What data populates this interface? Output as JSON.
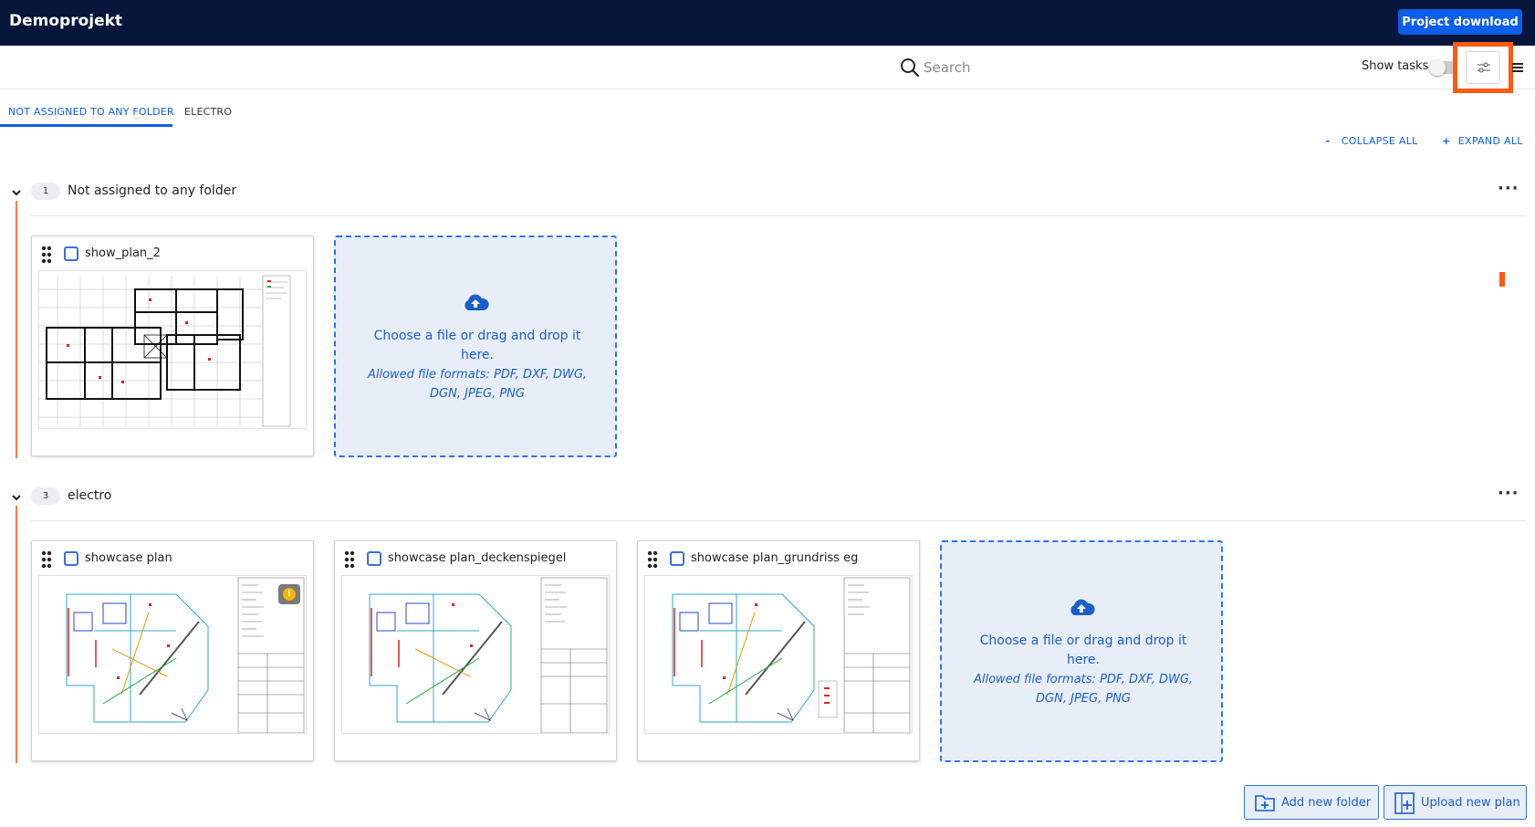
{
  "app": {
    "title": "Demoprojekt",
    "download_label": "Project download"
  },
  "toolbar": {
    "search_placeholder": "Search",
    "show_tasks_label": "Show tasks",
    "highlight_color": "#ff5a0d"
  },
  "tabs": [
    {
      "label": "NOT ASSIGNED TO ANY FOLDER",
      "active": true
    },
    {
      "label": "ELECTRO",
      "active": false
    }
  ],
  "controls": {
    "collapse_label": "COLLAPSE ALL",
    "expand_label": "EXPAND ALL"
  },
  "folders": [
    {
      "count": "1",
      "name": "Not assigned to any folder",
      "plans": [
        {
          "name": "show_plan_2"
        }
      ]
    },
    {
      "count": "3",
      "name": "electro",
      "plans": [
        {
          "name": "showcase plan",
          "warning": true
        },
        {
          "name": "showcase plan_deckenspiegel"
        },
        {
          "name": "showcase plan_grundriss eg"
        }
      ]
    }
  ],
  "dropzone": {
    "main_text": "Choose a file or drag and drop it here.",
    "formats_text": "Allowed file formats: PDF, DXF, DWG, DGN, JPEG, PNG"
  },
  "actions": {
    "add_folder_label": "Add new folder",
    "upload_label": "Upload new plan"
  },
  "colors": {
    "header_bg": "#07163a",
    "accent": "#0d5ee8",
    "folder_bar": "#ff7a3d"
  }
}
